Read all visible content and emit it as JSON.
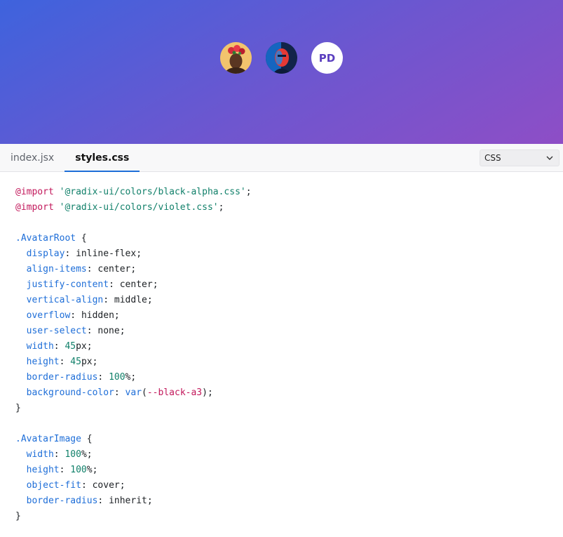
{
  "preview": {
    "avatars": [
      {
        "kind": "image",
        "icon": "avatar-photo-woman-flowers"
      },
      {
        "kind": "image",
        "icon": "avatar-photo-person-red-blue"
      },
      {
        "kind": "fallback",
        "initials": "PD"
      }
    ]
  },
  "editor": {
    "tabs": [
      {
        "label": "index.jsx",
        "active": false
      },
      {
        "label": "styles.css",
        "active": true
      }
    ],
    "language": "CSS",
    "code": {
      "l1": {
        "at": "@import",
        "str": "'@radix-ui/colors/black-alpha.css'",
        "end": ";"
      },
      "l2": {
        "at": "@import",
        "str": "'@radix-ui/colors/violet.css'",
        "end": ";"
      },
      "root_selector": ".AvatarRoot",
      "open": " {",
      "close": "}",
      "root_decls": [
        {
          "prop": "display",
          "val": "inline-flex",
          "end": ";"
        },
        {
          "prop": "align-items",
          "val": "center",
          "end": ";"
        },
        {
          "prop": "justify-content",
          "val": "center",
          "end": ";"
        },
        {
          "prop": "vertical-align",
          "val": "middle",
          "end": ";"
        },
        {
          "prop": "overflow",
          "val": "hidden",
          "end": ";"
        },
        {
          "prop": "user-select",
          "val": "none",
          "end": ";"
        },
        {
          "prop": "width",
          "num": "45",
          "unit": "px",
          "end": ";"
        },
        {
          "prop": "height",
          "num": "45",
          "unit": "px",
          "end": ";"
        },
        {
          "prop": "border-radius",
          "num": "100",
          "unit": "%",
          "end": ";"
        },
        {
          "prop": "background-color",
          "fn": "var",
          "arg": "--black-a3",
          "end": ");"
        }
      ],
      "image_selector": ".AvatarImage",
      "image_decls": [
        {
          "prop": "width",
          "num": "100",
          "unit": "%",
          "end": ";"
        },
        {
          "prop": "height",
          "num": "100",
          "unit": "%",
          "end": ";"
        },
        {
          "prop": "object-fit",
          "val": "cover",
          "end": ";"
        },
        {
          "prop": "border-radius",
          "val": "inherit",
          "end": ";"
        }
      ]
    }
  },
  "colors": {
    "accent": "#1e6ed8",
    "keyword": "#c2185b",
    "string": "#11806a",
    "gradient_start": "#3e63dd",
    "gradient_end": "#8e4ec6"
  }
}
